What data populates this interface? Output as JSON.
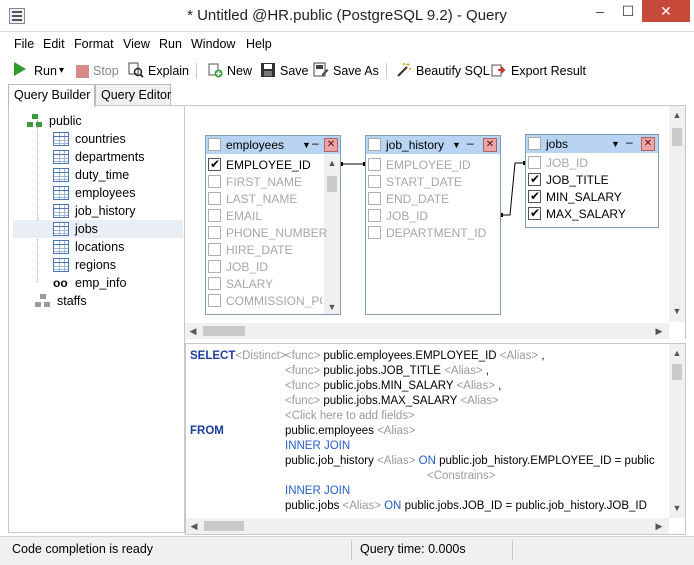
{
  "window": {
    "title": "* Untitled @HR.public (PostgreSQL 9.2) - Query",
    "min": "–",
    "max": "☐",
    "close": "✕"
  },
  "menu": [
    "File",
    "Edit",
    "Format",
    "View",
    "Run",
    "Window",
    "Help"
  ],
  "toolbar": {
    "run": "Run",
    "run_dropdown": "▾",
    "stop": "Stop",
    "explain": "Explain",
    "new": "New",
    "save": "Save",
    "save_as": "Save As",
    "beautify": "Beautify SQL",
    "export": "Export Result"
  },
  "tabs": [
    "Query Builder",
    "Query Editor"
  ],
  "tree": {
    "schema": "public",
    "tables": [
      "countries",
      "departments",
      "duty_time",
      "employees",
      "job_history",
      "jobs",
      "locations",
      "regions"
    ],
    "selected": "jobs",
    "view": "emp_info",
    "other_schema": "staffs"
  },
  "diagram": {
    "employees": {
      "name": "employees",
      "fields": [
        "EMPLOYEE_ID",
        "FIRST_NAME",
        "LAST_NAME",
        "EMAIL",
        "PHONE_NUMBER",
        "HIRE_DATE",
        "JOB_ID",
        "SALARY",
        "COMMISSION_PCT"
      ],
      "checked": [
        true,
        false,
        false,
        false,
        false,
        false,
        false,
        false,
        false
      ]
    },
    "job_history": {
      "name": "job_history",
      "fields": [
        "EMPLOYEE_ID",
        "START_DATE",
        "END_DATE",
        "JOB_ID",
        "DEPARTMENT_ID"
      ],
      "checked": [
        false,
        false,
        false,
        false,
        false
      ]
    },
    "jobs": {
      "name": "jobs",
      "fields": [
        "JOB_ID",
        "JOB_TITLE",
        "MIN_SALARY",
        "MAX_SALARY"
      ],
      "checked": [
        false,
        true,
        true,
        true
      ]
    }
  },
  "sql": {
    "select_kw": "SELECT",
    "distinct": "<Distinct>",
    "func": "<func>",
    "alias": "<Alias>",
    "comma": ",",
    "col1": "public.employees.EMPLOYEE_ID",
    "col2": "public.jobs.JOB_TITLE",
    "col3": "public.jobs.MIN_SALARY",
    "col4": "public.jobs.MAX_SALARY",
    "add_fields": "<Click here to add fields>",
    "from_kw": "FROM",
    "from_tbl": "public.employees",
    "inner_join": "INNER JOIN",
    "join1_tbl": "public.job_history",
    "on_kw": "ON",
    "join1_cond": "public.job_history.EMPLOYEE_ID = public",
    "constrains": "<Constrains>",
    "join2_tbl": "public.jobs",
    "join2_cond": "public.jobs.JOB_ID = public.job_history.JOB_ID"
  },
  "status": {
    "left": "Code completion is ready",
    "middle": "Query time: 0.000s"
  }
}
